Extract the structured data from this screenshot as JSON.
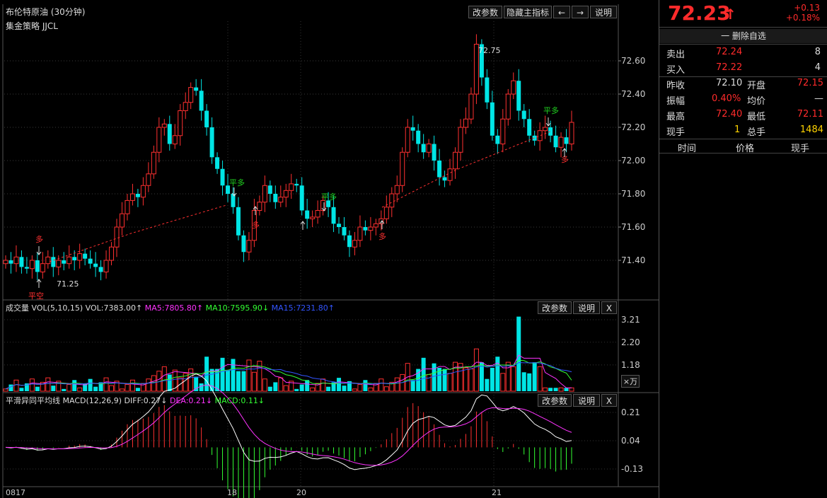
{
  "title": "布伦特原油 (30分钟)",
  "strategy": "集金策略 JJCL",
  "toolbar": {
    "params": "改参数",
    "hide_indicator": "隐藏主指标",
    "prev": "←",
    "next": "→",
    "explain": "说明",
    "close": "X"
  },
  "price_axis": [
    "72.60",
    "72.40",
    "72.20",
    "72.00",
    "71.80",
    "71.60",
    "71.40"
  ],
  "annotations": {
    "high_label": "72.75",
    "low_label": "71.25",
    "duo": "多",
    "ping_duo": "平多",
    "ping_kong": "平空"
  },
  "volume": {
    "legend_prefix": "成交量 VOL(5,10,15) VOL:7383.00↑",
    "ma5": "MA5:7805.80↑",
    "ma10": "MA10:7595.90↓",
    "ma15": "MA15:7231.80↑",
    "axis": [
      "3.21",
      "2.20",
      "1.18"
    ],
    "unit": "×万"
  },
  "macd": {
    "legend_prefix": "平滑异同平均线 MACD(12,26,9) DIFF:0.27↓",
    "dea": "DEA:0.21↓",
    "macd": "MACD:0.11↓",
    "axis": [
      "0.21",
      "0.04",
      "-0.13"
    ]
  },
  "time_axis": [
    "0817",
    "18",
    "20",
    "21"
  ],
  "colors": {
    "up": "#ff3030",
    "down": "#00e5e5",
    "ma5": "#ff33ff",
    "ma10": "#33ff33",
    "ma15": "#3355ff",
    "price_red": "#ff2b2b"
  },
  "quote": {
    "price": "72.23",
    "arrow": "↑",
    "change": "+0.13",
    "change_pct": "+0.18%",
    "remove_watch": "一 删除自选",
    "sell_label": "卖出",
    "sell_price": "72.24",
    "sell_qty": "8",
    "buy_label": "买入",
    "buy_price": "72.22",
    "buy_qty": "4",
    "prev_close_label": "昨收",
    "prev_close": "72.10",
    "open_label": "开盘",
    "open": "72.15",
    "amp_label": "振幅",
    "amp": "0.40%",
    "avg_label": "均价",
    "avg": "—",
    "high_label": "最高",
    "high": "72.40",
    "low_label": "最低",
    "low": "72.11",
    "now_label": "现手",
    "now": "1",
    "total_label": "总手",
    "total": "1484",
    "col_time": "时间",
    "col_price": "价格",
    "col_qty": "现手"
  }
}
